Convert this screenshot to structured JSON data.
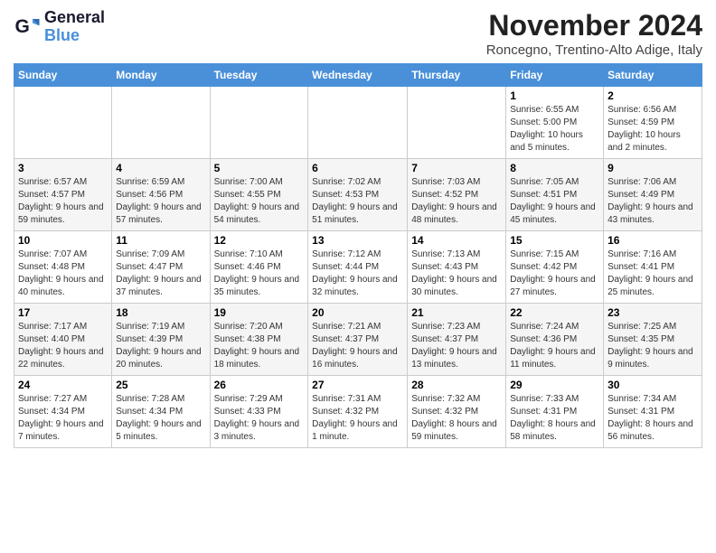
{
  "logo": {
    "line1": "General",
    "line2": "Blue"
  },
  "title": "November 2024",
  "location": "Roncegno, Trentino-Alto Adige, Italy",
  "days_of_week": [
    "Sunday",
    "Monday",
    "Tuesday",
    "Wednesday",
    "Thursday",
    "Friday",
    "Saturday"
  ],
  "weeks": [
    [
      {
        "day": "",
        "info": ""
      },
      {
        "day": "",
        "info": ""
      },
      {
        "day": "",
        "info": ""
      },
      {
        "day": "",
        "info": ""
      },
      {
        "day": "",
        "info": ""
      },
      {
        "day": "1",
        "info": "Sunrise: 6:55 AM\nSunset: 5:00 PM\nDaylight: 10 hours and 5 minutes."
      },
      {
        "day": "2",
        "info": "Sunrise: 6:56 AM\nSunset: 4:59 PM\nDaylight: 10 hours and 2 minutes."
      }
    ],
    [
      {
        "day": "3",
        "info": "Sunrise: 6:57 AM\nSunset: 4:57 PM\nDaylight: 9 hours and 59 minutes."
      },
      {
        "day": "4",
        "info": "Sunrise: 6:59 AM\nSunset: 4:56 PM\nDaylight: 9 hours and 57 minutes."
      },
      {
        "day": "5",
        "info": "Sunrise: 7:00 AM\nSunset: 4:55 PM\nDaylight: 9 hours and 54 minutes."
      },
      {
        "day": "6",
        "info": "Sunrise: 7:02 AM\nSunset: 4:53 PM\nDaylight: 9 hours and 51 minutes."
      },
      {
        "day": "7",
        "info": "Sunrise: 7:03 AM\nSunset: 4:52 PM\nDaylight: 9 hours and 48 minutes."
      },
      {
        "day": "8",
        "info": "Sunrise: 7:05 AM\nSunset: 4:51 PM\nDaylight: 9 hours and 45 minutes."
      },
      {
        "day": "9",
        "info": "Sunrise: 7:06 AM\nSunset: 4:49 PM\nDaylight: 9 hours and 43 minutes."
      }
    ],
    [
      {
        "day": "10",
        "info": "Sunrise: 7:07 AM\nSunset: 4:48 PM\nDaylight: 9 hours and 40 minutes."
      },
      {
        "day": "11",
        "info": "Sunrise: 7:09 AM\nSunset: 4:47 PM\nDaylight: 9 hours and 37 minutes."
      },
      {
        "day": "12",
        "info": "Sunrise: 7:10 AM\nSunset: 4:46 PM\nDaylight: 9 hours and 35 minutes."
      },
      {
        "day": "13",
        "info": "Sunrise: 7:12 AM\nSunset: 4:44 PM\nDaylight: 9 hours and 32 minutes."
      },
      {
        "day": "14",
        "info": "Sunrise: 7:13 AM\nSunset: 4:43 PM\nDaylight: 9 hours and 30 minutes."
      },
      {
        "day": "15",
        "info": "Sunrise: 7:15 AM\nSunset: 4:42 PM\nDaylight: 9 hours and 27 minutes."
      },
      {
        "day": "16",
        "info": "Sunrise: 7:16 AM\nSunset: 4:41 PM\nDaylight: 9 hours and 25 minutes."
      }
    ],
    [
      {
        "day": "17",
        "info": "Sunrise: 7:17 AM\nSunset: 4:40 PM\nDaylight: 9 hours and 22 minutes."
      },
      {
        "day": "18",
        "info": "Sunrise: 7:19 AM\nSunset: 4:39 PM\nDaylight: 9 hours and 20 minutes."
      },
      {
        "day": "19",
        "info": "Sunrise: 7:20 AM\nSunset: 4:38 PM\nDaylight: 9 hours and 18 minutes."
      },
      {
        "day": "20",
        "info": "Sunrise: 7:21 AM\nSunset: 4:37 PM\nDaylight: 9 hours and 16 minutes."
      },
      {
        "day": "21",
        "info": "Sunrise: 7:23 AM\nSunset: 4:37 PM\nDaylight: 9 hours and 13 minutes."
      },
      {
        "day": "22",
        "info": "Sunrise: 7:24 AM\nSunset: 4:36 PM\nDaylight: 9 hours and 11 minutes."
      },
      {
        "day": "23",
        "info": "Sunrise: 7:25 AM\nSunset: 4:35 PM\nDaylight: 9 hours and 9 minutes."
      }
    ],
    [
      {
        "day": "24",
        "info": "Sunrise: 7:27 AM\nSunset: 4:34 PM\nDaylight: 9 hours and 7 minutes."
      },
      {
        "day": "25",
        "info": "Sunrise: 7:28 AM\nSunset: 4:34 PM\nDaylight: 9 hours and 5 minutes."
      },
      {
        "day": "26",
        "info": "Sunrise: 7:29 AM\nSunset: 4:33 PM\nDaylight: 9 hours and 3 minutes."
      },
      {
        "day": "27",
        "info": "Sunrise: 7:31 AM\nSunset: 4:32 PM\nDaylight: 9 hours and 1 minute."
      },
      {
        "day": "28",
        "info": "Sunrise: 7:32 AM\nSunset: 4:32 PM\nDaylight: 8 hours and 59 minutes."
      },
      {
        "day": "29",
        "info": "Sunrise: 7:33 AM\nSunset: 4:31 PM\nDaylight: 8 hours and 58 minutes."
      },
      {
        "day": "30",
        "info": "Sunrise: 7:34 AM\nSunset: 4:31 PM\nDaylight: 8 hours and 56 minutes."
      }
    ]
  ]
}
